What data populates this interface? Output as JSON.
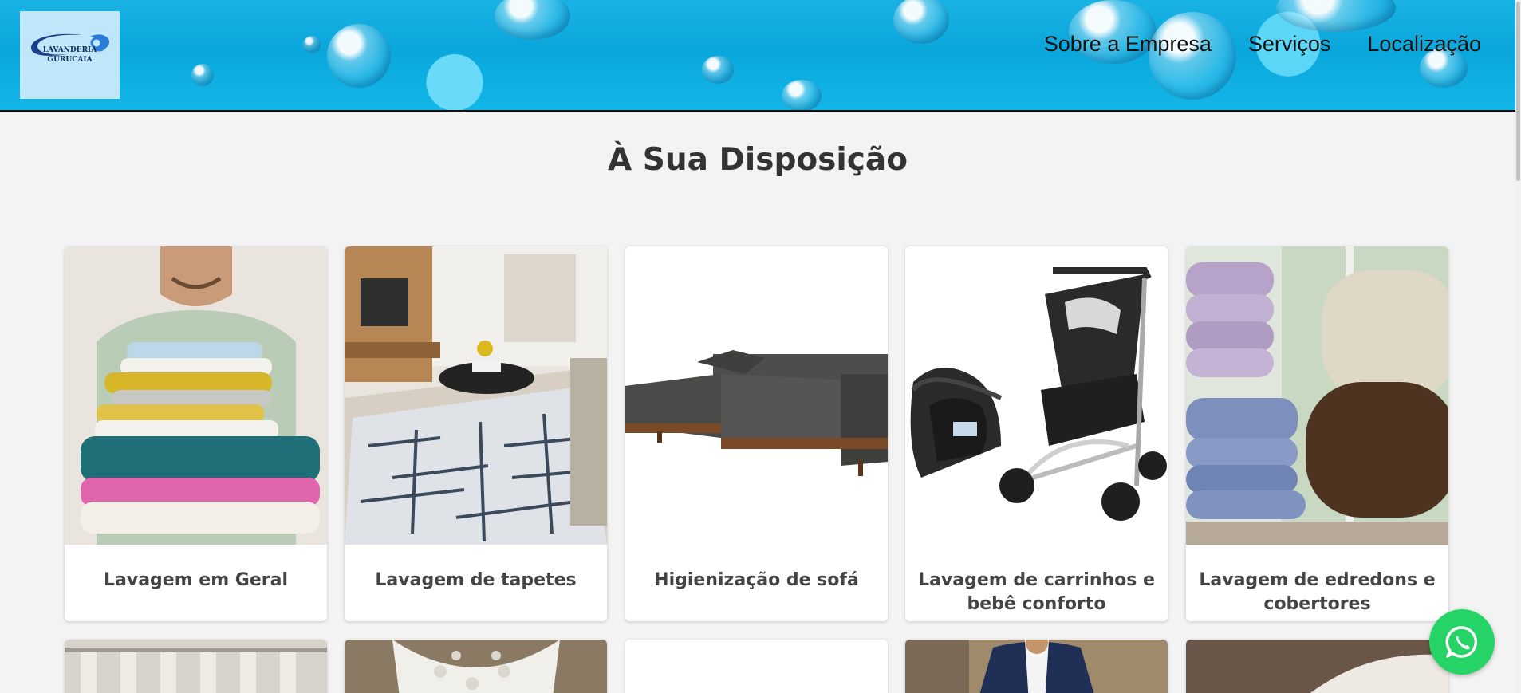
{
  "logo": {
    "line1": "LAVANDERIA",
    "line2": "GURUCAIA"
  },
  "nav": [
    "Sobre a Empresa",
    "Serviços",
    "Localização"
  ],
  "section_title": "À Sua Disposição",
  "services": [
    {
      "caption": "Lavagem em Geral",
      "image": "folded-clothes"
    },
    {
      "caption": "Lavagem de tapetes",
      "image": "living-room-rug"
    },
    {
      "caption": "Higienização de sofá",
      "image": "grey-sofa"
    },
    {
      "caption": "Lavagem de carrinhos e bebê conforto",
      "image": "stroller-and-car-seat"
    },
    {
      "caption": "Lavagem de edredons e cobertores",
      "image": "folded-blankets"
    }
  ],
  "colors": {
    "accent_blue": "#0aa7dc",
    "whatsapp_green": "#25d366"
  }
}
